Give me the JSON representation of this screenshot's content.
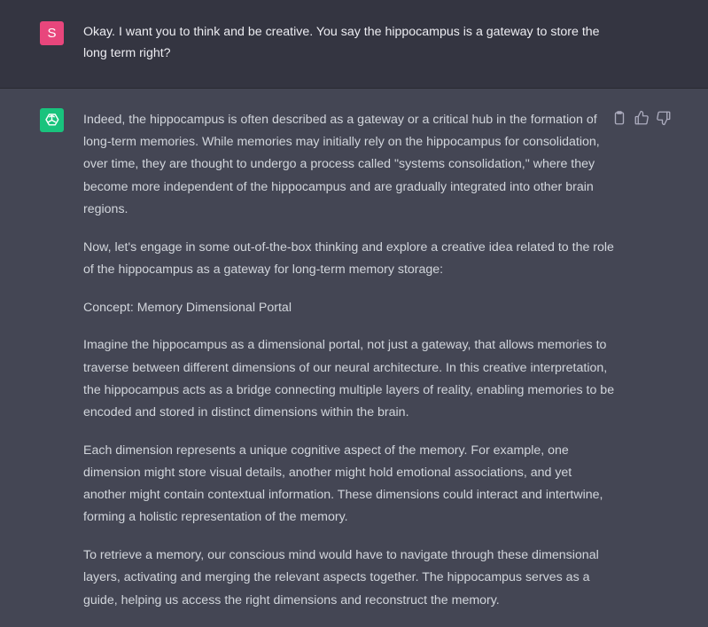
{
  "user_message": {
    "avatar_letter": "S",
    "text": "Okay. I want you to think and be creative. You say the hippocampus is a gateway to store the long term right?"
  },
  "assistant_message": {
    "paragraphs": [
      "Indeed, the hippocampus is often described as a gateway or a critical hub in the formation of long-term memories. While memories may initially rely on the hippocampus for consolidation, over time, they are thought to undergo a process called \"systems consolidation,\" where they become more independent of the hippocampus and are gradually integrated into other brain regions.",
      "Now, let's engage in some out-of-the-box thinking and explore a creative idea related to the role of the hippocampus as a gateway for long-term memory storage:",
      "Concept: Memory Dimensional Portal",
      "Imagine the hippocampus as a dimensional portal, not just a gateway, that allows memories to traverse between different dimensions of our neural architecture. In this creative interpretation, the hippocampus acts as a bridge connecting multiple layers of reality, enabling memories to be encoded and stored in distinct dimensions within the brain.",
      "Each dimension represents a unique cognitive aspect of the memory. For example, one dimension might store visual details, another might hold emotional associations, and yet another might contain contextual information. These dimensions could interact and intertwine, forming a holistic representation of the memory.",
      "To retrieve a memory, our conscious mind would have to navigate through these dimensional layers, activating and merging the relevant aspects together. The hippocampus serves as a guide, helping us access the right dimensions and reconstruct the memory."
    ]
  },
  "actions": {
    "icons": [
      "clipboard-icon",
      "thumbs-up-icon",
      "thumbs-down-icon"
    ]
  },
  "colors": {
    "user_bg": "#343541",
    "assistant_bg": "#444654",
    "user_avatar": "#e8467c",
    "bot_avatar": "#19c37d",
    "text": "#d1d5db"
  }
}
